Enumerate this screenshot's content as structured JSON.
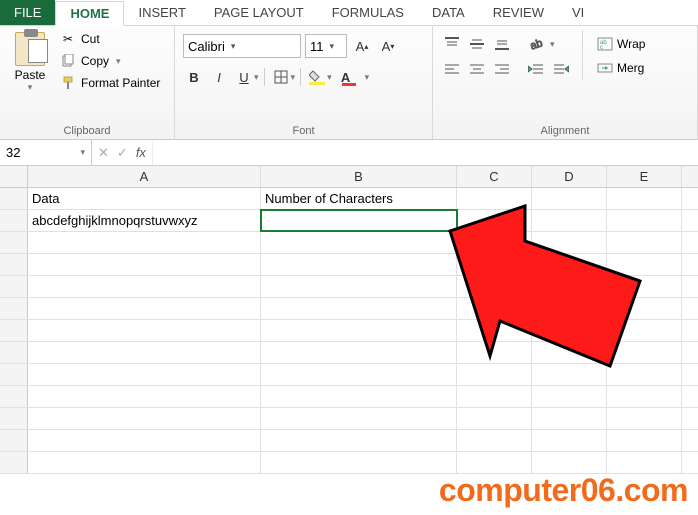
{
  "tabs": {
    "file": "FILE",
    "home": "HOME",
    "insert": "INSERT",
    "page_layout": "PAGE LAYOUT",
    "formulas": "FORMULAS",
    "data": "DATA",
    "review": "REVIEW",
    "view": "VI"
  },
  "clipboard": {
    "paste": "Paste",
    "cut": "Cut",
    "copy": "Copy",
    "format_painter": "Format Painter",
    "group": "Clipboard"
  },
  "font": {
    "name": "Calibri",
    "size": "11",
    "group": "Font",
    "bold": "B",
    "italic": "I",
    "underline": "U"
  },
  "alignment": {
    "group": "Alignment",
    "wrap": "Wrap",
    "merge": "Merg"
  },
  "namebox": "32",
  "fx": "fx",
  "columns": {
    "A": "A",
    "B": "B",
    "C": "C",
    "D": "D",
    "E": "E"
  },
  "cells": {
    "A1": "Data",
    "B1": "Number of Characters",
    "A2": "abcdefghijklmnopqrstuvwxyz"
  },
  "watermark": "computer06.com",
  "chart_data": {
    "type": "table",
    "selected_cell": "B2",
    "columns": [
      "A",
      "B"
    ],
    "rows": [
      {
        "A": "Data",
        "B": "Number of Characters"
      },
      {
        "A": "abcdefghijklmnopqrstuvwxyz",
        "B": ""
      }
    ]
  }
}
